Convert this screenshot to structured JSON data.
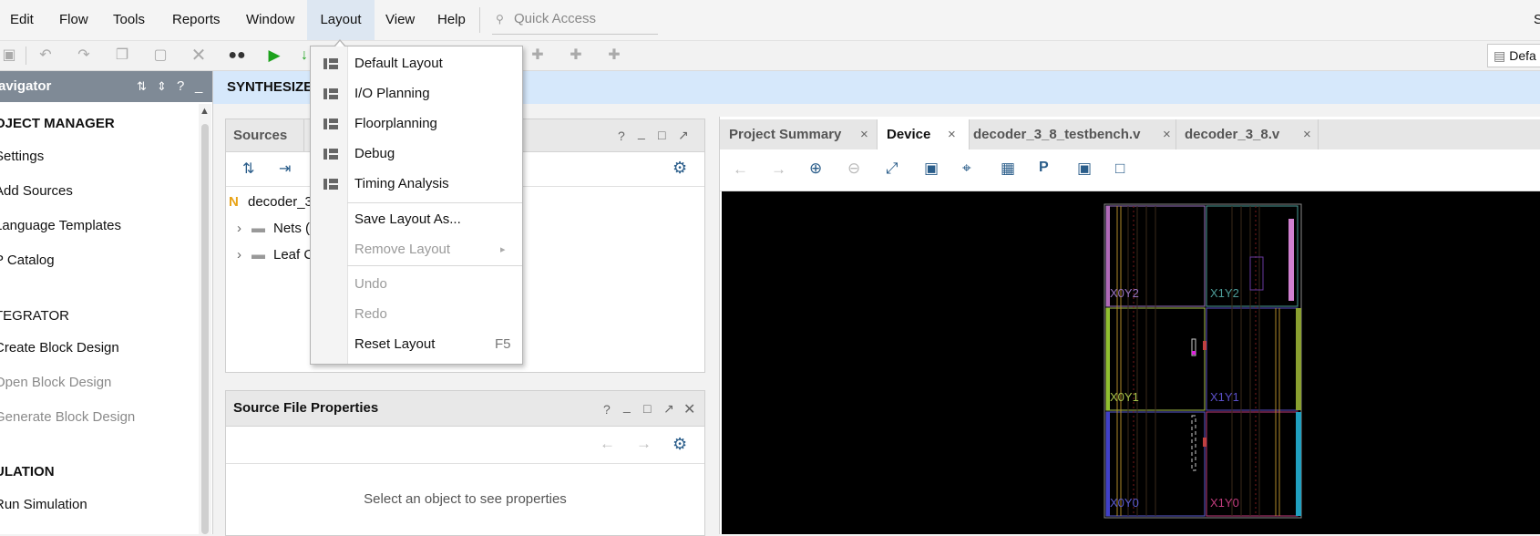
{
  "menubar": {
    "items": [
      "Edit",
      "Flow",
      "Tools",
      "Reports",
      "Window",
      "Layout",
      "View",
      "Help"
    ],
    "quick_access_placeholder": "Quick Access",
    "right_edge_text": "S"
  },
  "toolbar": {
    "layout_select_value": "Defa"
  },
  "flow_navigator": {
    "title": "avigator",
    "sections": {
      "project_manager": "OJECT MANAGER",
      "integrator": "TEGRATOR",
      "simulation": "ULATION"
    },
    "items": {
      "settings": "Settings",
      "add_sources": "Add Sources",
      "language_templates": "Language Templates",
      "ip_catalog": "P Catalog",
      "create_block_design": "Create Block Design",
      "open_block_design": "Open Block Design",
      "generate_block_design": "Generate Block Design",
      "run_simulation": "Run Simulation"
    }
  },
  "banner": {
    "text": "SYNTHESIZE"
  },
  "sources_panel": {
    "tab": "Sources",
    "tree": {
      "root": "decoder_3",
      "root_badge": "N",
      "nets": "Nets (",
      "leaf": "Leaf C"
    }
  },
  "source_file_properties": {
    "title": "Source File Properties",
    "empty_message": "Select an object to see properties"
  },
  "device_view": {
    "tabs": [
      "Project Summary",
      "Device",
      "decoder_3_8_testbench.v",
      "decoder_3_8.v"
    ],
    "regions": [
      "X0Y2",
      "X1Y2",
      "X0Y1",
      "X1Y1",
      "X0Y0",
      "X1Y0"
    ]
  },
  "layout_menu": {
    "items": {
      "default_layout": "Default Layout",
      "io_planning": "I/O Planning",
      "floorplanning": "Floorplanning",
      "debug": "Debug",
      "timing_analysis": "Timing Analysis",
      "save_layout_as": "Save Layout As...",
      "remove_layout": "Remove Layout",
      "undo": "Undo",
      "redo": "Redo",
      "reset_layout": "Reset Layout",
      "reset_layout_shortcut": "F5"
    }
  },
  "colors": {
    "banner_bg": "#d6e8fb",
    "nav_header_bg": "#7f8a96",
    "menu_active_bg": "#dde7f2",
    "canvas_bg": "#000000"
  }
}
